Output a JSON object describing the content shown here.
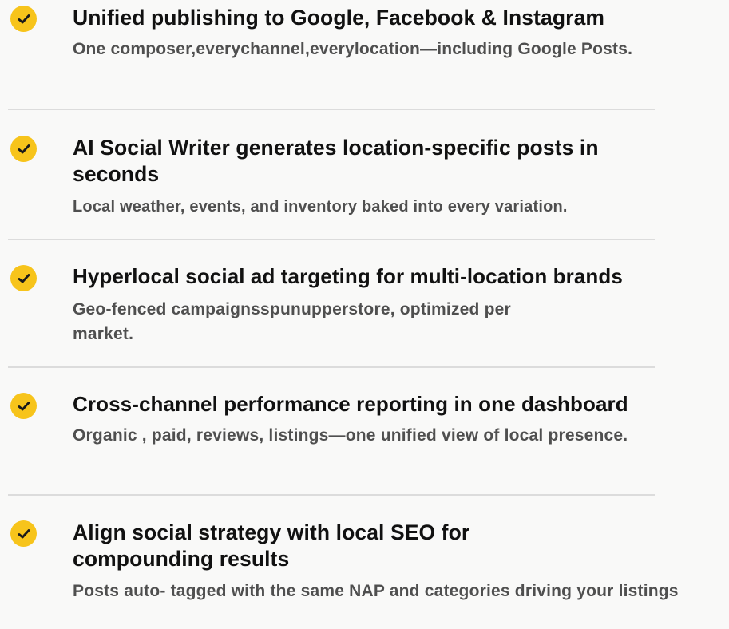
{
  "colors": {
    "check_fill": "#f7c41b",
    "check_mark": "#1a1a1a",
    "title": "#111111",
    "description": "#4f4f4f",
    "divider": "#dcdcdc",
    "background": "#f9f9f8"
  },
  "features": [
    {
      "icon": "check-circle-icon",
      "title": "Unified publishing to Google, Facebook & Instagram",
      "description": "One composer,everychannel,everylocation—including Google Posts."
    },
    {
      "icon": "check-circle-icon",
      "title": "AI Social Writer generates location-specific posts in seconds",
      "description": "Local weather, events, and inventory baked into every variation."
    },
    {
      "icon": "check-circle-icon",
      "title": "Hyperlocal social ad targeting for multi-location brands",
      "description": "Geo-fenced campaignsspunupperstore, optimized per market."
    },
    {
      "icon": "check-circle-icon",
      "title": "Cross-channel performance reporting in one dashboard",
      "description": "Organic , paid, reviews, listings—one unified view of local presence."
    },
    {
      "icon": "check-circle-icon",
      "title": "Align social strategy with local SEO for compounding results",
      "description": "Posts auto- tagged with the same NAP and categories driving your listings"
    }
  ]
}
